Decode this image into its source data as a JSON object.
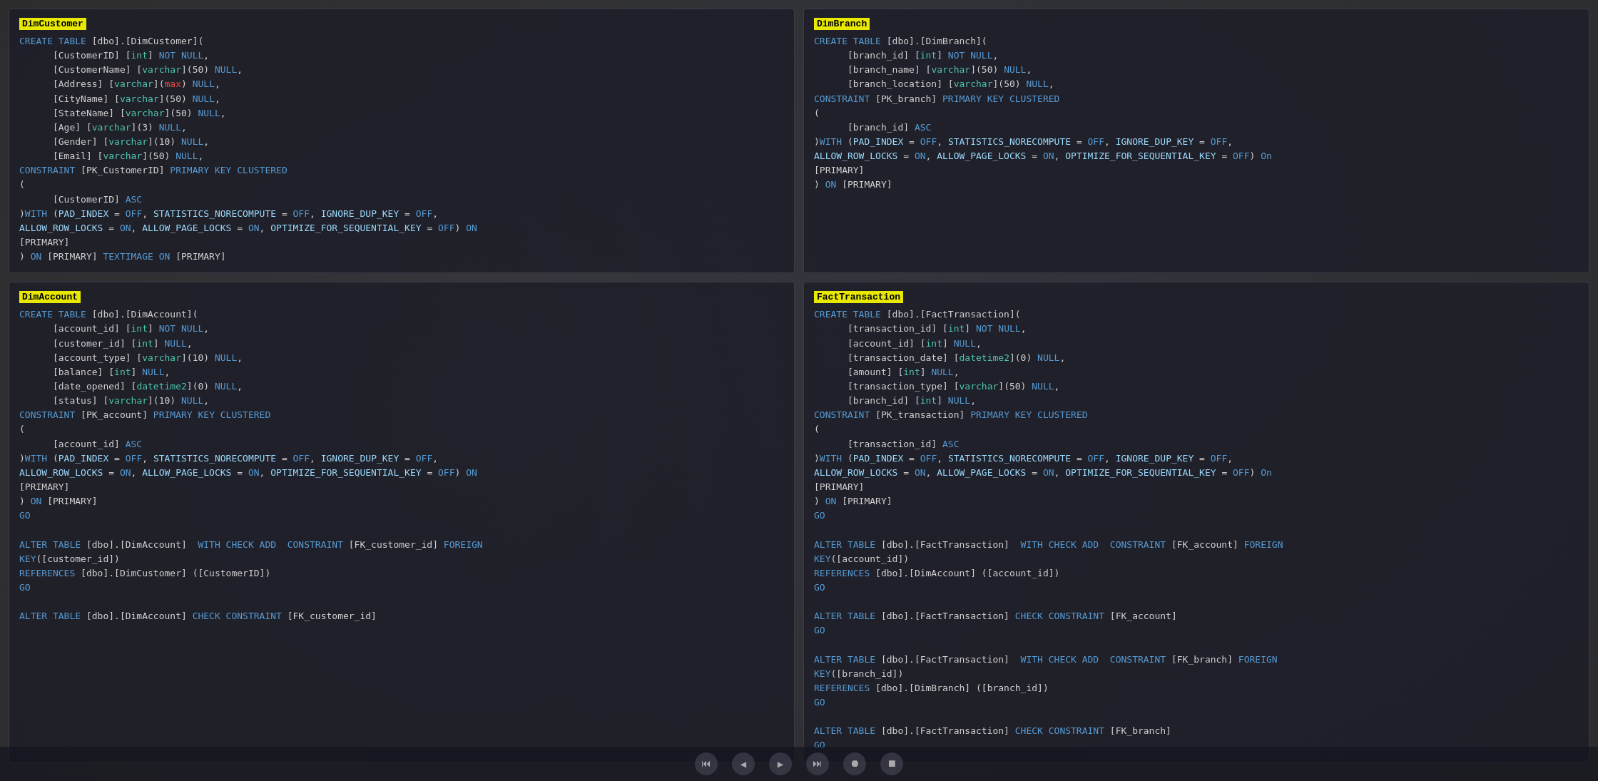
{
  "panels": {
    "dimcustomer": {
      "title": "DimCustomer",
      "code": "CREATE TABLE [dbo].[DimCustomer](\n\t[CustomerID] [int] NOT NULL,\n\t[CustomerName] [varchar](50) NULL,\n\t[Address] [varchar](max) NULL,\n\t[CityName] [varchar](50) NULL,\n\t[StateName] [varchar](50) NULL,\n\t[Age] [varchar](3) NULL,\n\t[Gender] [varchar](10) NULL,\n\t[Email] [varchar](50) NULL,\nCONSTRAINT [PK_CustomerID] PRIMARY KEY CLUSTERED\n(\n\t[CustomerID] ASC\n)WITH (PAD_INDEX = OFF, STATISTICS_NORECOMPUTE = OFF, IGNORE_DUP_KEY = OFF,\nALLOW_ROW_LOCKS = ON, ALLOW_PAGE_LOCKS = ON, OPTIMIZE_FOR_SEQUENTIAL_KEY = OFF) ON\n[PRIMARY]\n) ON [PRIMARY] TEXTIMAGE ON [PRIMARY]"
    },
    "dimaccount": {
      "title": "DimAccount",
      "code": "CREATE TABLE [dbo].[DimAccount](\n\t[account_id] [int] NOT NULL,\n\t[customer_id] [int] NULL,\n\t[account_type] [varchar](10) NULL,\n\t[balance] [int] NULL,\n\t[date_opened] [datetime2](0) NULL,\n\t[status] [varchar](10) NULL,\nCONSTRAINT [PK_account] PRIMARY KEY CLUSTERED\n(\n\t[account_id] ASC\n)WITH (PAD_INDEX = OFF, STATISTICS_NORECOMPUTE = OFF, IGNORE_DUP_KEY = OFF,\nALLOW_ROW_LOCKS = ON, ALLOW_PAGE_LOCKS = ON, OPTIMIZE_FOR_SEQUENTIAL_KEY = OFF) ON\n[PRIMARY]\n) ON [PRIMARY]\nGO\n\nALTER TABLE [dbo].[DimAccount]  WITH CHECK ADD  CONSTRAINT [FK_customer_id] FOREIGN\nKEY([customer_id])\nREFERENCES [dbo].[DimCustomer] ([CustomerID])\nGO\n\nALTER TABLE [dbo].[DimAccount] CHECK CONSTRAINT [FK_customer_id]"
    },
    "dimbranch": {
      "title": "DimBranch",
      "code": "CREATE TABLE [dbo].[DimBranch](\n\t[branch_id] [int] NOT NULL,\n\t[branch_name] [varchar](50) NULL,\n\t[branch_location] [varchar](50) NULL,\nCONSTRAINT [PK_branch] PRIMARY KEY CLUSTERED\n(\n\t[branch_id] ASC\n)WITH (PAD_INDEX = OFF, STATISTICS_NORECOMPUTE = OFF, IGNORE_DUP_KEY = OFF,\nALLOW_ROW_LOCKS = ON, ALLOW_PAGE_LOCKS = ON, OPTIMIZE_FOR_SEQUENTIAL_KEY = OFF) On\n[PRIMARY]\n) ON [PRIMARY]"
    },
    "facttransaction": {
      "title": "FactTransaction",
      "code_part1": "CREATE TABLE [dbo].[FactTransaction](\n\t[transaction_id] [int] NOT NULL,\n\t[account_id] [int] NULL,\n\t[transaction_date] [datetime2](0) NULL,\n\t[amount] [int] NULL,\n\t[transaction_type] [varchar](50) NULL,\n\t[branch_id] [int] NULL,\nCONSTRAINT [PK_transaction] PRIMARY KEY CLUSTERED\n(\n\t[transaction_id] ASC\n)WITH (PAD_INDEX = OFF, STATISTICS_NORECOMPUTE = OFF, IGNORE_DUP_KEY = OFF,\nALLOW_ROW_LOCKS = ON, ALLOW_PAGE_LOCKS = ON, OPTIMIZE_FOR_SEQUENTIAL_KEY = OFF) On\n[PRIMARY]\n) ON [PRIMARY]\nGO",
      "code_part2": "\n\nALTER TABLE [dbo].[FactTransaction]  WITH CHECK ADD  CONSTRAINT [FK_account] FOREIGN\nKEY([account_id])\nREFERENCES [dbo].[DimAccount] ([account_id])\nGO\n\nALTER TABLE [dbo].[FactTransaction] CHECK CONSTRAINT [FK_account]\nGO\n\nALTER TABLE [dbo].[FactTransaction]  WITH CHECK ADD  CONSTRAINT [FK_branch] FOREIGN\nKEY([branch_id])\nREFERENCES [dbo].[DimBranch] ([branch_id])\nGO\n\nALTER TABLE [dbo].[FactTransaction] CHECK CONSTRAINT [FK_branch]\nGO"
    }
  },
  "toolbar": {
    "icons": [
      "⏮",
      "◀",
      "▶",
      "⏭",
      "⏺",
      "⏹"
    ]
  }
}
